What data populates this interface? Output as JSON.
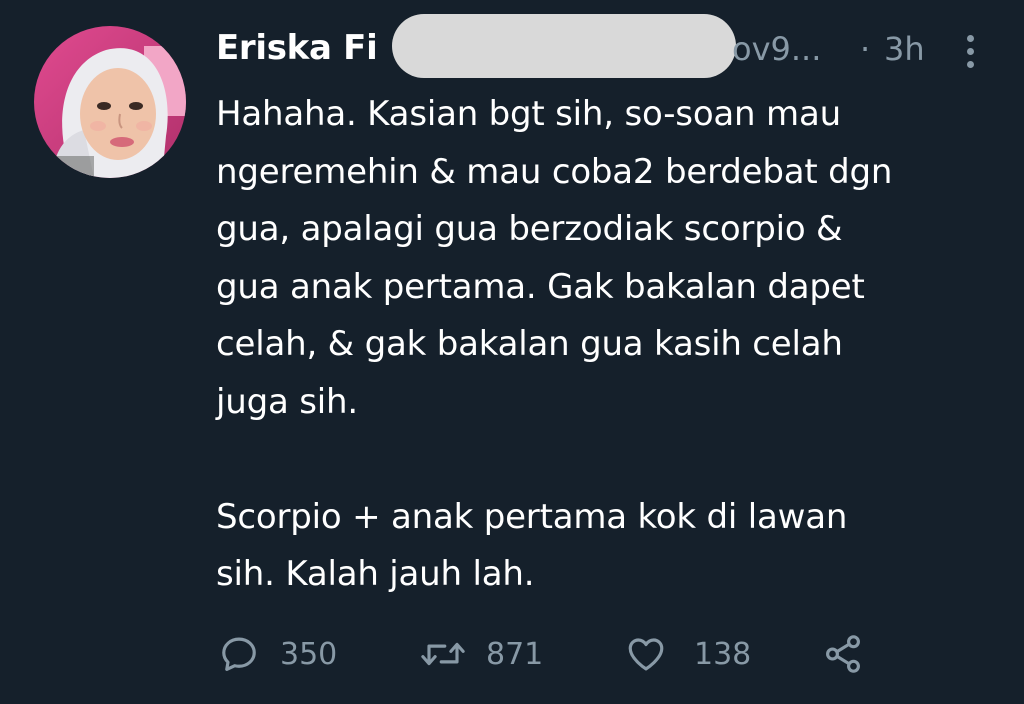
{
  "tweet": {
    "author_name": "Eriska Fi",
    "handle": "ov9...",
    "separator": "·",
    "time": "3h",
    "body": "Hahaha. Kasian bgt sih, so-soan mau ngeremehin & mau coba2 berdebat dgn gua, apalagi gua berzodiak scorpio & gua anak pertama. Gak bakalan dapet celah, & gak bakalan gua kasih celah juga sih.\n\nScorpio + anak pertama kok di lawan sih. Kalah jauh lah.",
    "body_lines": [
      "Hahaha. Kasian bgt sih, so-soan mau",
      "ngeremehin & mau coba2 berdebat dgn",
      "gua, apalagi gua berzodiak scorpio &",
      "gua anak pertama. Gak bakalan dapet",
      "celah, & gak bakalan gua kasih celah",
      "juga sih.",
      "",
      "Scorpio + anak pertama kok di lawan",
      "sih. Kalah jauh lah."
    ],
    "actions": {
      "replies": "350",
      "retweets": "871",
      "likes": "138"
    }
  },
  "theme": {
    "background": "#15202b",
    "text": "#ffffff",
    "muted": "#8899a6",
    "redaction": "#d9d9d9"
  },
  "icons": [
    "reply-icon",
    "retweet-icon",
    "like-icon",
    "share-icon",
    "more-options-icon"
  ]
}
